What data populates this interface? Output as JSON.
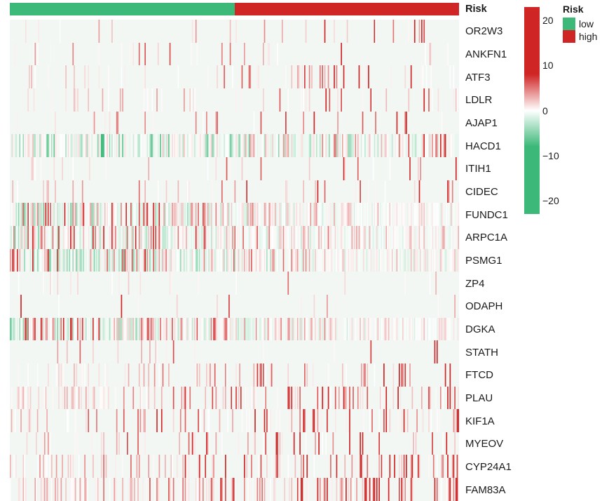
{
  "annotation": {
    "name": "Risk",
    "row_label": "Risk",
    "segments": [
      {
        "label": "low",
        "color": "#3cb878",
        "fraction": 0.5007
      },
      {
        "label": "high",
        "color": "#d02525",
        "fraction": 0.4993
      }
    ]
  },
  "legend": {
    "title": "Risk",
    "entries": [
      {
        "label": "low",
        "color": "#3cb878"
      },
      {
        "label": "high",
        "color": "#d02525"
      }
    ]
  },
  "colorbar": {
    "ticks": [
      "20",
      "10",
      "0",
      "-10",
      "-20"
    ],
    "tick_values": [
      20,
      10,
      0,
      -10,
      -20
    ],
    "min": -23,
    "max": 23,
    "low_color": "#3cb878",
    "mid_color": "#ffffff",
    "high_color": "#d02525",
    "saturation_low": -8,
    "saturation_high": 8
  },
  "chart_data": {
    "type": "heatmap",
    "title": "",
    "xlabel": "",
    "ylabel": "",
    "n_columns": 380,
    "background_color": "#f2f7f4",
    "colorbar_range": [
      -23,
      23
    ],
    "column_groups": [
      {
        "name": "low",
        "start": 0,
        "end": 190
      },
      {
        "name": "high",
        "start": 190,
        "end": 380
      }
    ],
    "row_labels": [
      "OR2W3",
      "ANKFN1",
      "ATF3",
      "LDLR",
      "AJAP1",
      "HACD1",
      "ITIH1",
      "CIDEC",
      "FUNDC1",
      "ARPC1A",
      "PSMG1",
      "ZP4",
      "ODAPH",
      "DGKA",
      "STATH",
      "FTCD",
      "PLAU",
      "KIF1A",
      "MYEOV",
      "CYP24A1",
      "FAM83A"
    ],
    "row_profiles": [
      {
        "gene": "OR2W3",
        "density": 0.09,
        "red_bias": 0.97,
        "green_amp": 0.6,
        "red_amp": 13.0,
        "right_skew": 0.72,
        "base": 0.1,
        "seed": 101
      },
      {
        "gene": "ANKFN1",
        "density": 0.07,
        "red_bias": 0.98,
        "green_amp": 0.5,
        "red_amp": 14.0,
        "right_skew": 0.78,
        "base": 0.1,
        "seed": 202
      },
      {
        "gene": "ATF3",
        "density": 0.13,
        "red_bias": 0.95,
        "green_amp": 0.8,
        "red_amp": 11.0,
        "right_skew": 0.7,
        "base": 0.2,
        "seed": 303
      },
      {
        "gene": "LDLR",
        "density": 0.14,
        "red_bias": 0.93,
        "green_amp": 1.0,
        "red_amp": 9.5,
        "right_skew": 0.66,
        "base": 0.2,
        "seed": 404
      },
      {
        "gene": "AJAP1",
        "density": 0.08,
        "red_bias": 0.96,
        "green_amp": 0.6,
        "red_amp": 12.0,
        "right_skew": 0.74,
        "base": 0.1,
        "seed": 505
      },
      {
        "gene": "HACD1",
        "density": 0.86,
        "red_bias": 0.46,
        "green_amp": 5.0,
        "red_amp": 7.0,
        "right_skew": 0.5,
        "base": 1.0,
        "seed": 606
      },
      {
        "gene": "ITIH1",
        "density": 0.1,
        "red_bias": 0.94,
        "green_amp": 0.7,
        "red_amp": 12.5,
        "right_skew": 0.62,
        "base": 0.1,
        "seed": 707
      },
      {
        "gene": "CIDEC",
        "density": 0.09,
        "red_bias": 0.95,
        "green_amp": 0.7,
        "red_amp": 13.5,
        "right_skew": 0.68,
        "base": 0.1,
        "seed": 808
      },
      {
        "gene": "FUNDC1",
        "density": 0.92,
        "red_bias": 0.44,
        "green_amp": 4.0,
        "red_amp": 9.0,
        "right_skew": 0.3,
        "base": 1.0,
        "seed": 909
      },
      {
        "gene": "ARPC1A",
        "density": 0.9,
        "red_bias": 0.47,
        "green_amp": 3.6,
        "red_amp": 10.0,
        "right_skew": 0.28,
        "base": 1.0,
        "seed": 1010
      },
      {
        "gene": "PSMG1",
        "density": 0.93,
        "red_bias": 0.45,
        "green_amp": 4.2,
        "red_amp": 9.5,
        "right_skew": 0.27,
        "base": 1.0,
        "seed": 1111
      },
      {
        "gene": "ZP4",
        "density": 0.05,
        "red_bias": 0.97,
        "green_amp": 0.4,
        "red_amp": 8.0,
        "right_skew": 0.6,
        "base": 0.05,
        "seed": 1212
      },
      {
        "gene": "ODAPH",
        "density": 0.05,
        "red_bias": 0.98,
        "green_amp": 0.4,
        "red_amp": 14.0,
        "right_skew": 0.35,
        "base": 0.05,
        "seed": 1313
      },
      {
        "gene": "DGKA",
        "density": 0.91,
        "red_bias": 0.48,
        "green_amp": 3.4,
        "red_amp": 9.0,
        "right_skew": 0.26,
        "base": 1.0,
        "seed": 1414
      },
      {
        "gene": "STATH",
        "density": 0.05,
        "red_bias": 0.98,
        "green_amp": 0.4,
        "red_amp": 15.0,
        "right_skew": 0.8,
        "base": 0.05,
        "seed": 1515
      },
      {
        "gene": "FTCD",
        "density": 0.16,
        "red_bias": 0.95,
        "green_amp": 0.8,
        "red_amp": 12.0,
        "right_skew": 0.73,
        "base": 0.2,
        "seed": 1616
      },
      {
        "gene": "PLAU",
        "density": 0.34,
        "red_bias": 0.96,
        "green_amp": 0.8,
        "red_amp": 12.0,
        "right_skew": 0.8,
        "base": 0.4,
        "seed": 1717
      },
      {
        "gene": "KIF1A",
        "density": 0.22,
        "red_bias": 0.96,
        "green_amp": 0.7,
        "red_amp": 13.5,
        "right_skew": 0.82,
        "base": 0.3,
        "seed": 1818
      },
      {
        "gene": "MYEOV",
        "density": 0.18,
        "red_bias": 0.97,
        "green_amp": 0.6,
        "red_amp": 14.0,
        "right_skew": 0.8,
        "base": 0.2,
        "seed": 1919
      },
      {
        "gene": "CYP24A1",
        "density": 0.24,
        "red_bias": 0.96,
        "green_amp": 0.7,
        "red_amp": 13.0,
        "right_skew": 0.78,
        "base": 0.3,
        "seed": 2020
      },
      {
        "gene": "FAM83A",
        "density": 0.4,
        "red_bias": 0.96,
        "green_amp": 0.9,
        "red_amp": 12.5,
        "right_skew": 0.76,
        "base": 0.5,
        "seed": 2121
      }
    ]
  }
}
